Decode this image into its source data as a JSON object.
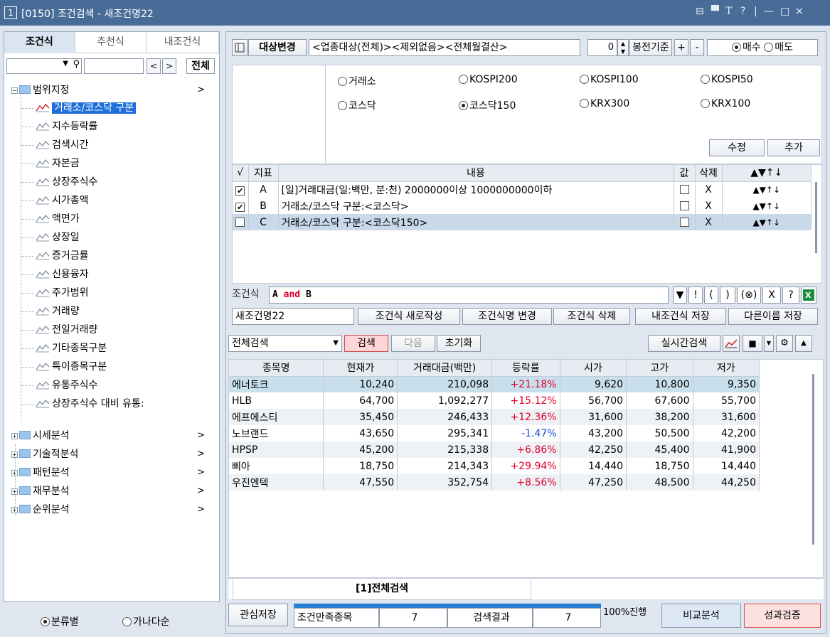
{
  "window": {
    "number": "1",
    "title": "[0150] 조건검색 - 새조건명22",
    "controls": [
      "⊟",
      "▀",
      "T",
      "?",
      "|",
      "—",
      "□",
      "×"
    ]
  },
  "left": {
    "tabs": [
      "조건식",
      "추천식",
      "내조건식"
    ],
    "filter_select_value": "",
    "nav_prev": "<",
    "nav_next": ">",
    "all_button": "전체",
    "tree": {
      "root": "범위지정",
      "children": [
        "거래소/코스닥 구분",
        "지수등락률",
        "검색시간",
        "자본금",
        "상장주식수",
        "시가총액",
        "액면가",
        "상장일",
        "증거금률",
        "신용융자",
        "주가범위",
        "거래량",
        "전일거래량",
        "기타종목구분",
        "특이종목구분",
        "유통주식수",
        "상장주식수 대비 유통:"
      ],
      "selected_child": "거래소/코스닥 구분",
      "folders": [
        "시세분석",
        "기술적분석",
        "패턴분석",
        "재무분석",
        "순위분석"
      ],
      "expand_arrow": ">"
    },
    "sort_options": {
      "by_category": "분류별",
      "by_alpha": "가나다순",
      "selected": "분류별"
    }
  },
  "right": {
    "target_change_button": "대상변경",
    "target_text": "<업종대상(전체)><제외없음><전체월결산>",
    "candle_value": "0",
    "candle_basis": "봉전기준",
    "plus": "+",
    "minus": "-",
    "buy": "매수",
    "sell": "매도",
    "trade_selected": "매수",
    "markets": [
      "거래소",
      "KOSPI200",
      "KOSPI100",
      "KOSPI50",
      "코스닥",
      "코스닥150",
      "KRX300",
      "KRX100"
    ],
    "market_selected": "코스닥150",
    "modify_button": "수정",
    "add_button": "추가",
    "cond_headers": {
      "check": "√",
      "index": "지표",
      "content": "내용",
      "value": "값",
      "delete": "삭제",
      "order": "▲▼↑↓"
    },
    "conditions": [
      {
        "checked": true,
        "id": "A",
        "content": "[일]거래대금(일:백만, 분:천) 2000000이상 1000000000이하",
        "del": "X",
        "order": "▲▼↑↓"
      },
      {
        "checked": true,
        "id": "B",
        "content": "거래소/코스닥 구분:<코스닥>",
        "del": "X",
        "order": "▲▼↑↓"
      },
      {
        "checked": false,
        "id": "C",
        "content": "거래소/코스닥 구분:<코스닥150>",
        "del": "X",
        "order": "▲▼↑↓"
      }
    ],
    "formula_label": "조건식",
    "formula": {
      "a": "A",
      "op": "and",
      "b": "B"
    },
    "formula_buttons": [
      "▼",
      "!",
      "(",
      ")",
      "(⊗)",
      "X",
      "?"
    ],
    "cond_name": "새조건명22",
    "new_button": "조건식 새로작성",
    "rename_button": "조건식명 변경",
    "delete_button": "조건식 삭제",
    "save_button": "내조건식 저장",
    "save_as_button": "다른이름 저장",
    "search_scope": "전체검색",
    "search_button": "검색",
    "next_button": "다음",
    "reset_button": "초기화",
    "realtime_button": "실시간검색",
    "result_headers": [
      "종목명",
      "현재가",
      "거래대금(백만)",
      "등락률",
      "시가",
      "고가",
      "저가"
    ],
    "results": [
      [
        "에너토크",
        "10,240",
        "210,098",
        "+21.18%",
        "9,620",
        "10,800",
        "9,350"
      ],
      [
        "HLB",
        "64,700",
        "1,092,277",
        "+15.12%",
        "56,700",
        "67,600",
        "55,700"
      ],
      [
        "에프에스티",
        "35,450",
        "246,433",
        "+12.36%",
        "31,600",
        "38,200",
        "31,600"
      ],
      [
        "노브랜드",
        "43,650",
        "295,341",
        "-1.47%",
        "43,200",
        "50,500",
        "42,200"
      ],
      [
        "HPSP",
        "45,200",
        "215,338",
        "+6.86%",
        "42,250",
        "45,400",
        "41,900"
      ],
      [
        "삐아",
        "18,750",
        "214,343",
        "+29.94%",
        "14,440",
        "18,750",
        "14,440"
      ],
      [
        "우진엔텍",
        "47,550",
        "352,754",
        "+8.56%",
        "47,250",
        "48,500",
        "44,250"
      ]
    ],
    "result_tab": "[1]전체검색",
    "watch_save": "관심저장",
    "match_label": "조건만족종목",
    "match_count": "7",
    "result_label": "검색결과",
    "result_count": "7",
    "progress": "100%진행",
    "compare_button": "비교분석",
    "performance_button": "성과검증"
  },
  "colors": {
    "title": "#486c98",
    "selected": "#1e6fd9",
    "up": "#e0002a",
    "down": "#1a4fd8",
    "accent_row": "#c8e0ec"
  }
}
